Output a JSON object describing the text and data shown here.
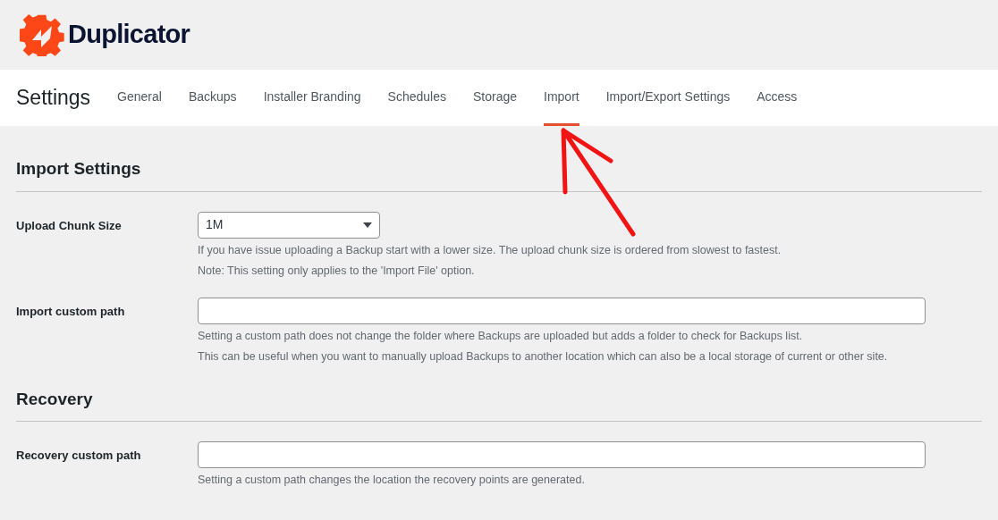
{
  "logo": {
    "text": "Duplicator"
  },
  "page_title": "Settings",
  "tabs": [
    {
      "label": "General",
      "selected": false
    },
    {
      "label": "Backups",
      "selected": false
    },
    {
      "label": "Installer Branding",
      "selected": false
    },
    {
      "label": "Schedules",
      "selected": false
    },
    {
      "label": "Storage",
      "selected": false
    },
    {
      "label": "Import",
      "selected": true
    },
    {
      "label": "Import/Export Settings",
      "selected": false
    },
    {
      "label": "Access",
      "selected": false
    }
  ],
  "sections": [
    {
      "title": "Import Settings",
      "fields": [
        {
          "label": "Upload Chunk Size",
          "kind": "select",
          "value": "1M",
          "descriptions": [
            "If you have issue uploading a Backup start with a lower size. The upload chunk size is ordered from slowest to fastest.",
            "Note: This setting only applies to the 'Import File' option."
          ]
        },
        {
          "label": "Import custom path",
          "kind": "text",
          "descriptions": [
            "Setting a custom path does not change the folder where Backups are uploaded but adds a folder to check for Backups list.",
            "This can be useful when you want to manually upload Backups to another location which can also be a local storage of current or other site."
          ]
        }
      ]
    },
    {
      "title": "Recovery",
      "fields": [
        {
          "label": "Recovery custom path",
          "kind": "text",
          "descriptions": [
            "Setting a custom path changes the location the recovery points are generated."
          ]
        }
      ]
    }
  ]
}
